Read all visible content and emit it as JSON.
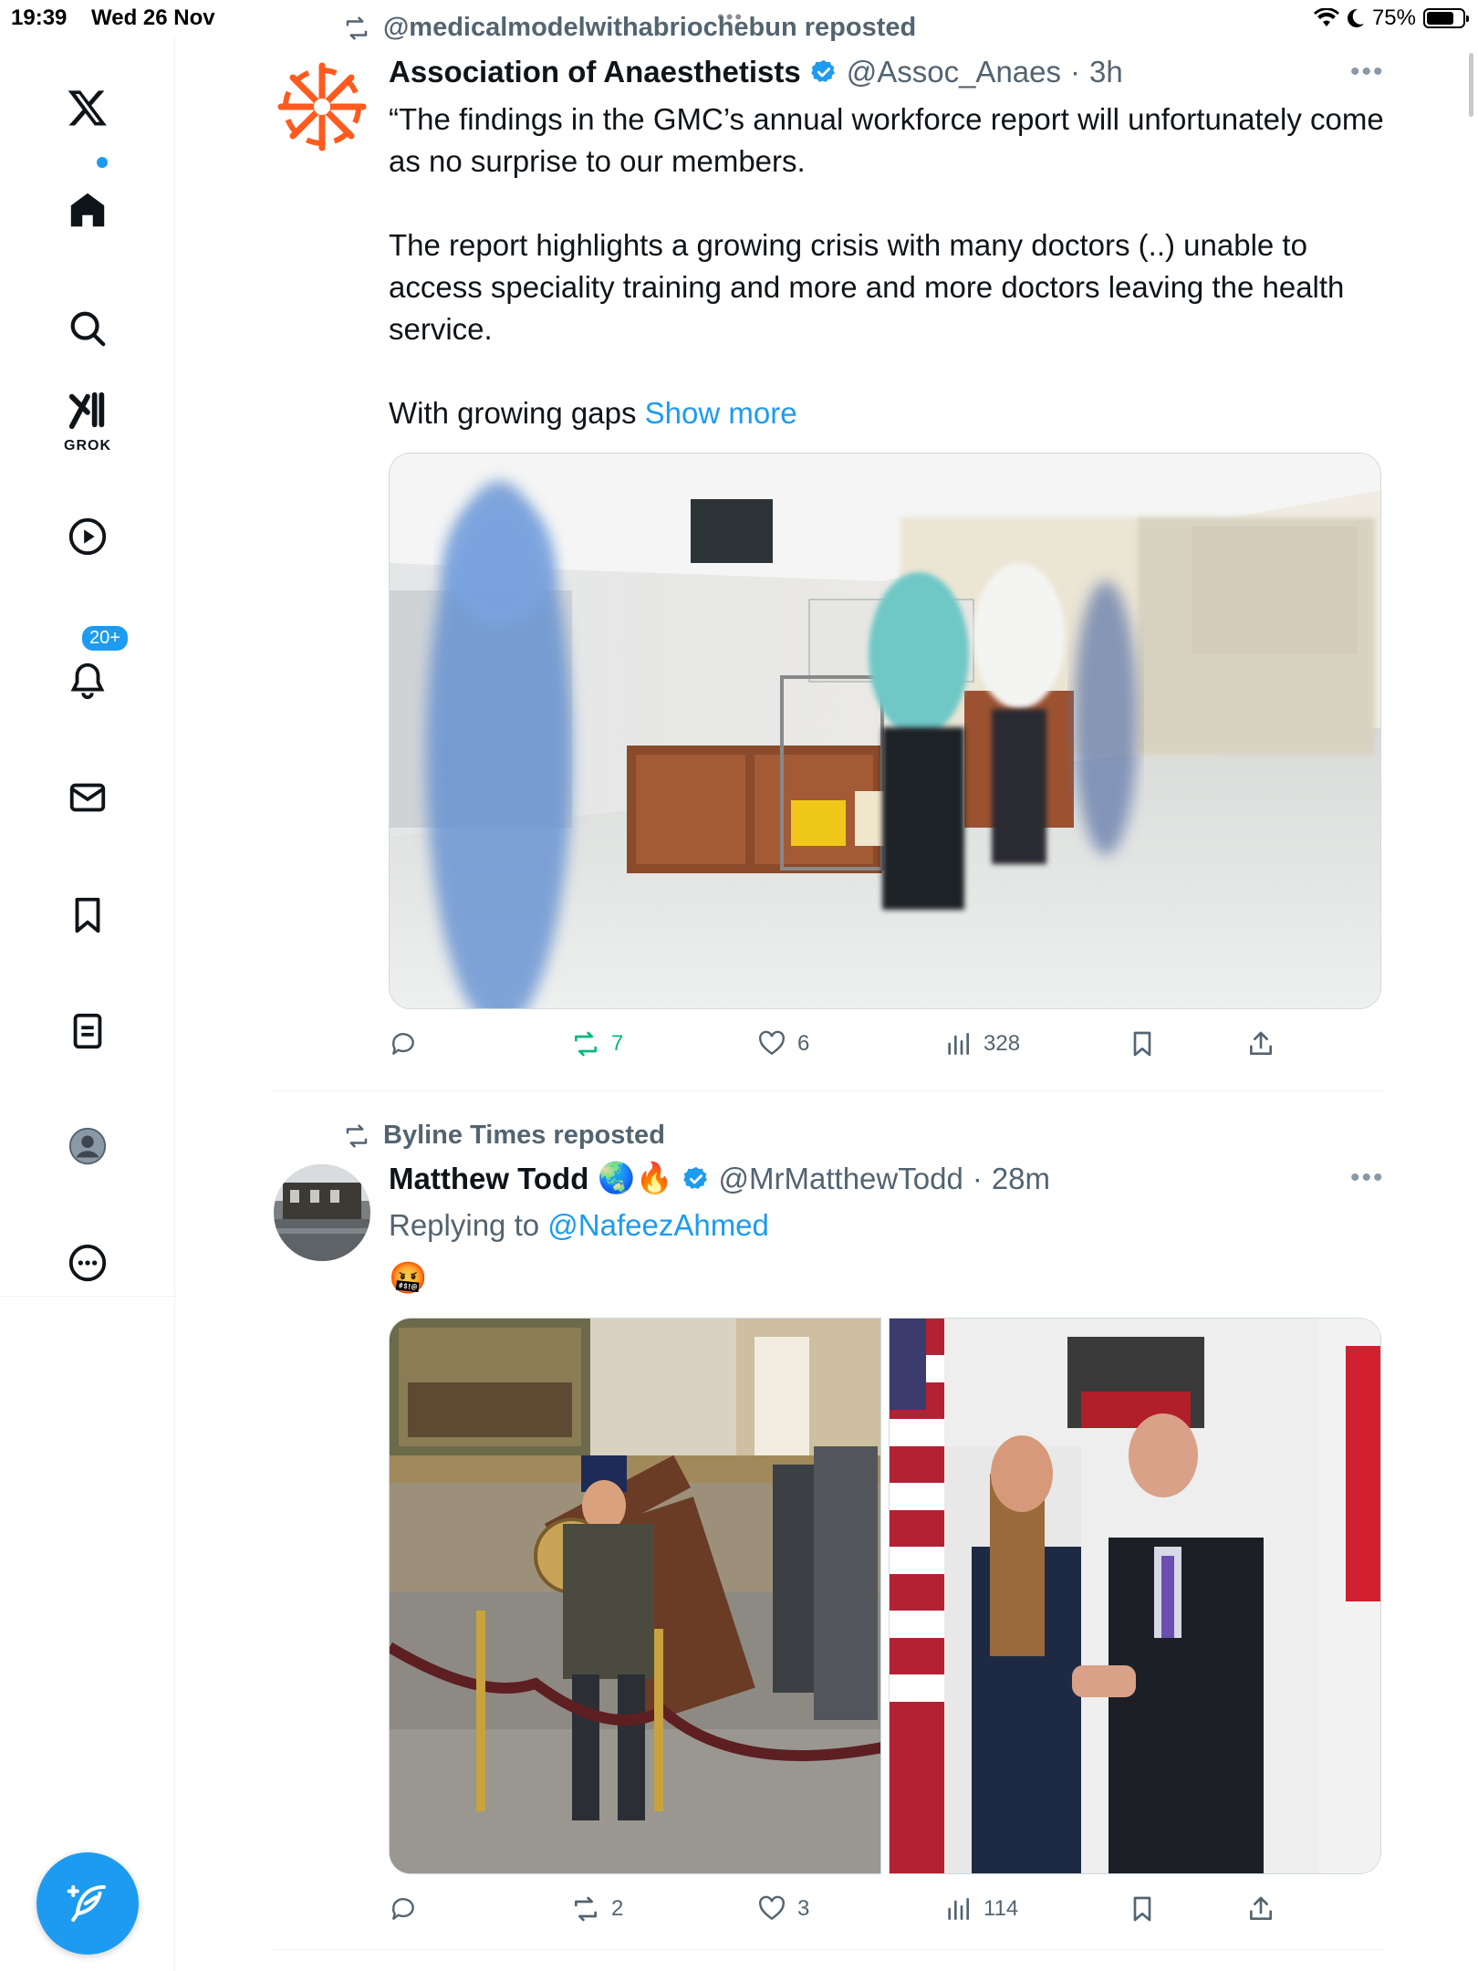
{
  "status_bar": {
    "time": "19:39",
    "date": "Wed 26 Nov",
    "battery": "75%",
    "battery_level": 0.75
  },
  "sidebar": {
    "grok_label": "GROK",
    "notifications_badge": "20+"
  },
  "tweets": [
    {
      "repost_by": "@medicalmodelwithabriochebun reposted",
      "author": "Association of Anaesthetists",
      "handle": "@Assoc_Anaes",
      "dot": "·",
      "time": "3h",
      "paragraphs": [
        "“The findings in the GMC’s annual workforce report will unfortunately come as no surprise to our members.",
        "The report highlights a growing crisis with many doctors (..) unable to access speciality training and more and more doctors leaving the health service."
      ],
      "truncated_text": "With growing gaps ",
      "show_more": "Show more",
      "stats": {
        "reposts": "7",
        "likes": "6",
        "views": "328"
      }
    },
    {
      "repost_by": "Byline Times reposted",
      "author": "Matthew Todd",
      "emojis": "🌏🔥",
      "handle": "@MrMatthewTodd",
      "dot": "·",
      "time": "28m",
      "replying_prefix": "Replying to ",
      "replying_handle": "@NafeezAhmed",
      "body_emoji": "🤬",
      "stats": {
        "reposts": "2",
        "likes": "3",
        "views": "114"
      }
    }
  ],
  "colors": {
    "accent": "#1d9bf0",
    "repost_green": "#00ba7c",
    "secondary_text": "#536471",
    "avatar_orange": "#ff5a1f"
  }
}
